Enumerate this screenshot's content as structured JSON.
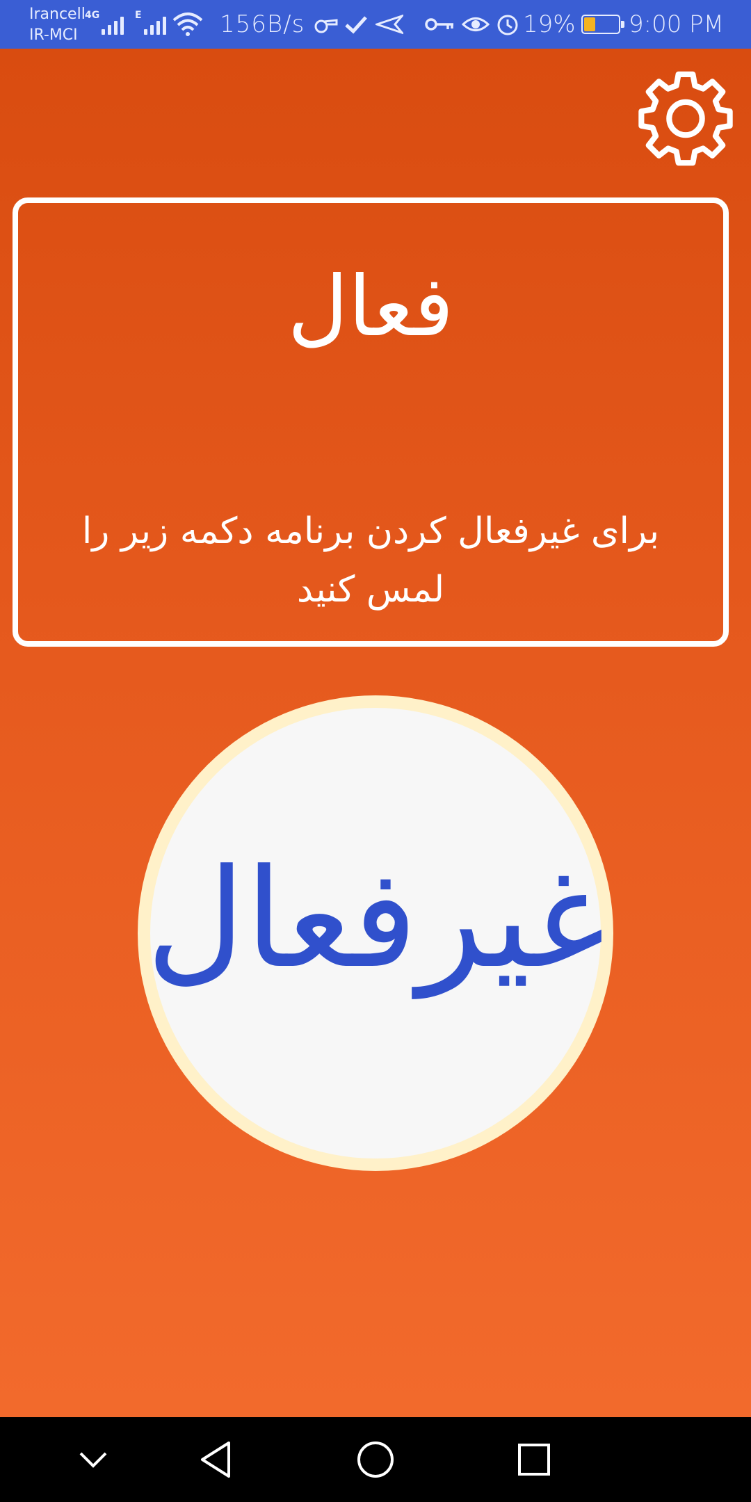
{
  "status_bar": {
    "carrier_primary": "Irancell",
    "carrier_secondary": "IR-MCI",
    "network_type_1": "4G",
    "network_type_2": "E",
    "speed": "156B/s",
    "battery_percent": "19%",
    "time": "9:00 PM",
    "icons": [
      "signal-icon",
      "signal-icon",
      "wifi-icon",
      "whistle-icon",
      "check-icon",
      "send-icon",
      "key-icon",
      "eye-icon",
      "alarm-icon",
      "battery-icon"
    ]
  },
  "app": {
    "status_title": "فعال",
    "status_description": "برای غیرفعال کردن برنامه دکمه زیر را لمس کنید",
    "toggle_label": "غیرفعال",
    "settings_icon": "gear-icon",
    "colors": {
      "background_top": "#d94c10",
      "background_bottom": "#f26a2c",
      "button_label": "#3050cc",
      "button_ring": "#fff1c9"
    }
  },
  "navigation_bar": {
    "buttons": [
      "chevron-down-icon",
      "back-icon",
      "home-icon",
      "recents-icon"
    ]
  }
}
